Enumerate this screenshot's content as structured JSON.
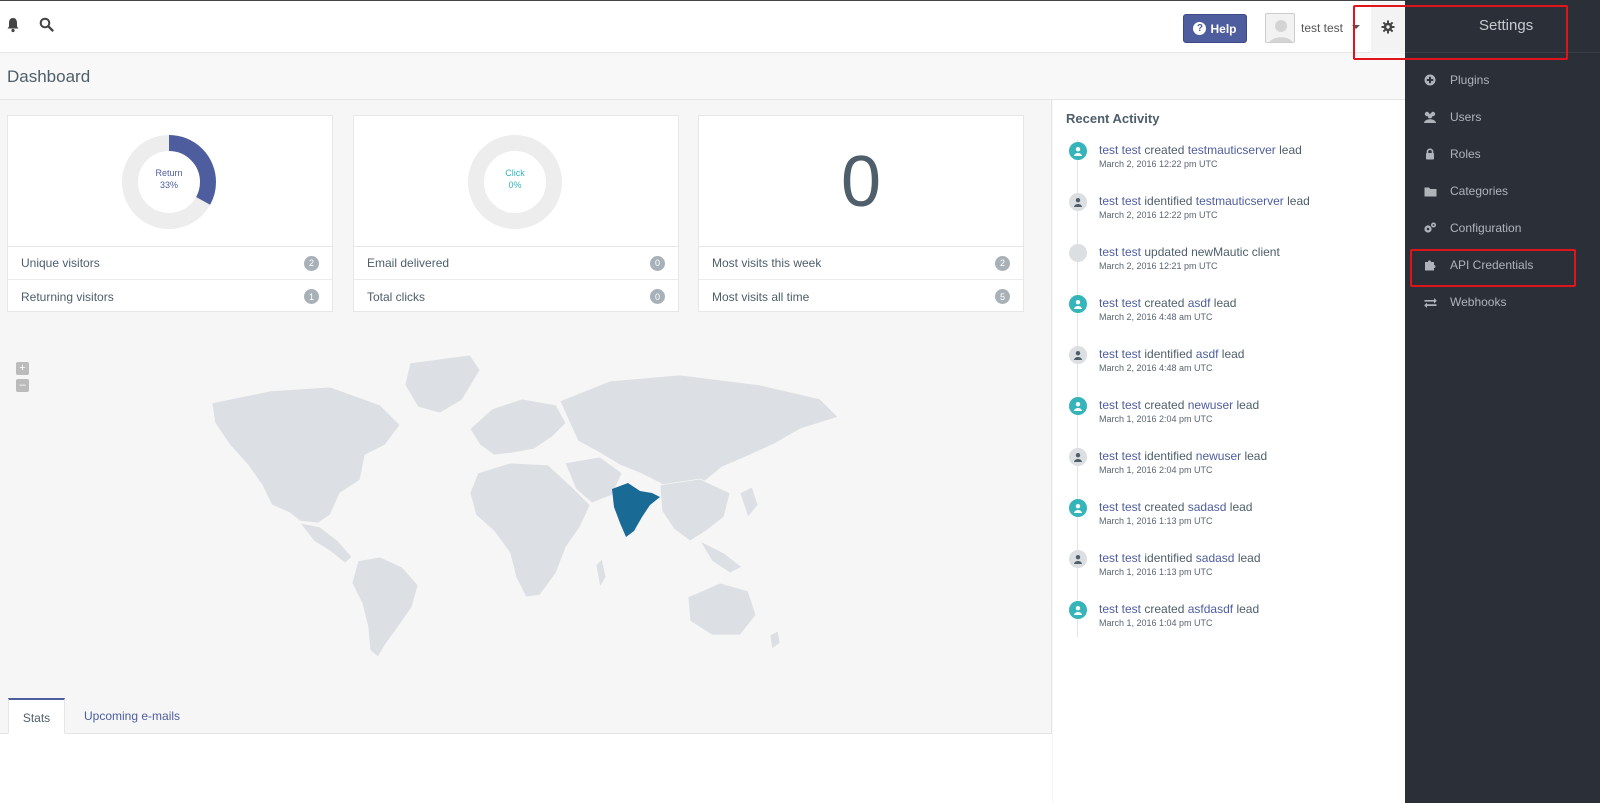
{
  "topbar": {
    "notifications_icon": "bell-icon",
    "search_icon": "search-icon",
    "help_label": "Help",
    "user_name": "test test",
    "settings_icon": "gear-icon"
  },
  "page": {
    "title": "Dashboard"
  },
  "cards": [
    {
      "donut_label": "Return",
      "donut_value": "33%",
      "donut_fraction": 0.33,
      "accent": "#4e5d9d",
      "rows": [
        {
          "label": "Unique visitors",
          "count": "2"
        },
        {
          "label": "Returning visitors",
          "count": "1"
        }
      ]
    },
    {
      "donut_label": "Click",
      "donut_value": "0%",
      "donut_fraction": 0,
      "accent": "#35b4b9",
      "rows": [
        {
          "label": "Email delivered",
          "count": "0"
        },
        {
          "label": "Total clicks",
          "count": "0"
        }
      ]
    },
    {
      "big_number": "0",
      "rows": [
        {
          "label": "Most visits this week",
          "count": "2"
        },
        {
          "label": "Most visits all time",
          "count": "5"
        }
      ]
    }
  ],
  "map": {
    "zoom_in": "+",
    "zoom_out": "–",
    "highlight_color": "#1a6a96"
  },
  "tabs": [
    {
      "label": "Stats"
    },
    {
      "label": "Upcoming e-mails"
    }
  ],
  "recent_activity": {
    "title": "Recent Activity",
    "items": [
      {
        "user": "test test",
        "action": "created",
        "target": "testmauticserver",
        "suffix": "lead",
        "date": "March 2, 2016 12:22 pm UTC",
        "dot": "green"
      },
      {
        "user": "test test",
        "action": "identified",
        "target": "testmauticserver",
        "suffix": "lead",
        "date": "March 2, 2016 12:22 pm UTC",
        "dot": "gray"
      },
      {
        "user": "test test",
        "action": "updated newMautic client",
        "target": "",
        "suffix": "",
        "date": "March 2, 2016 12:21 pm UTC",
        "dot": "blank"
      },
      {
        "user": "test test",
        "action": "created",
        "target": "asdf",
        "suffix": "lead",
        "date": "March 2, 2016 4:48 am UTC",
        "dot": "green"
      },
      {
        "user": "test test",
        "action": "identified",
        "target": "asdf",
        "suffix": "lead",
        "date": "March 2, 2016 4:48 am UTC",
        "dot": "gray"
      },
      {
        "user": "test test",
        "action": "created",
        "target": "newuser",
        "suffix": "lead",
        "date": "March 1, 2016 2:04 pm UTC",
        "dot": "green"
      },
      {
        "user": "test test",
        "action": "identified",
        "target": "newuser",
        "suffix": "lead",
        "date": "March 1, 2016 2:04 pm UTC",
        "dot": "gray"
      },
      {
        "user": "test test",
        "action": "created",
        "target": "sadasd",
        "suffix": "lead",
        "date": "March 1, 2016 1:13 pm UTC",
        "dot": "green"
      },
      {
        "user": "test test",
        "action": "identified",
        "target": "sadasd",
        "suffix": "lead",
        "date": "March 1, 2016 1:13 pm UTC",
        "dot": "gray"
      },
      {
        "user": "test test",
        "action": "created",
        "target": "asfdasdf",
        "suffix": "lead",
        "date": "March 1, 2016 1:04 pm UTC",
        "dot": "green"
      }
    ]
  },
  "settings": {
    "title": "Settings",
    "items": [
      {
        "label": "Plugins",
        "icon": "plus-circle-icon"
      },
      {
        "label": "Users",
        "icon": "users-icon"
      },
      {
        "label": "Roles",
        "icon": "lock-icon"
      },
      {
        "label": "Categories",
        "icon": "folder-icon"
      },
      {
        "label": "Configuration",
        "icon": "gears-icon"
      },
      {
        "label": "API Credentials",
        "icon": "puzzle-icon"
      },
      {
        "label": "Webhooks",
        "icon": "exchange-icon"
      }
    ]
  }
}
